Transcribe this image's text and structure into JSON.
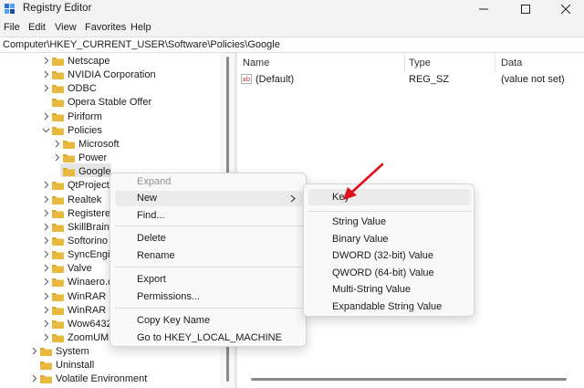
{
  "window": {
    "title": "Registry Editor"
  },
  "menu": [
    "File",
    "Edit",
    "View",
    "Favorites",
    "Help"
  ],
  "address": "Computer\\HKEY_CURRENT_USER\\Software\\Policies\\Google",
  "tree": [
    {
      "label": "Netscape",
      "state": "collapsed"
    },
    {
      "label": "NVIDIA Corporation",
      "state": "collapsed"
    },
    {
      "label": "ODBC",
      "state": "collapsed"
    },
    {
      "label": "Opera Stable Offer",
      "state": "none"
    },
    {
      "label": "Piriform",
      "state": "collapsed"
    },
    {
      "label": "Policies",
      "state": "expanded"
    },
    {
      "label": "Microsoft",
      "state": "collapsed"
    },
    {
      "label": "Power",
      "state": "collapsed"
    },
    {
      "label": "Google",
      "state": "selected"
    },
    {
      "label": "QtProject",
      "state": "collapsed"
    },
    {
      "label": "Realtek",
      "state": "collapsed"
    },
    {
      "label": "Registered",
      "state": "collapsed"
    },
    {
      "label": "SkillBrains",
      "state": "collapsed"
    },
    {
      "label": "Softorino",
      "state": "collapsed"
    },
    {
      "label": "SyncEngin",
      "state": "collapsed"
    },
    {
      "label": "Valve",
      "state": "collapsed"
    },
    {
      "label": "Winaero.c",
      "state": "collapsed"
    },
    {
      "label": "WinRAR",
      "state": "collapsed"
    },
    {
      "label": "WinRAR S",
      "state": "collapsed"
    },
    {
      "label": "Wow6432",
      "state": "collapsed"
    },
    {
      "label": "ZoomUM",
      "state": "collapsed"
    },
    {
      "label": "System",
      "state": "collapsed"
    },
    {
      "label": "Uninstall",
      "state": "none"
    },
    {
      "label": "Volatile Environment",
      "state": "collapsed"
    }
  ],
  "list": {
    "columns": [
      "Name",
      "Type",
      "Data"
    ],
    "rows": [
      {
        "name": "(Default)",
        "type": "REG_SZ",
        "data": "(value not set)"
      }
    ]
  },
  "context_menu": {
    "expand": "Expand",
    "new": "New",
    "find": "Find...",
    "delete": "Delete",
    "rename": "Rename",
    "export": "Export",
    "permissions": "Permissions...",
    "copy_key_name": "Copy Key Name",
    "goto": "Go to HKEY_LOCAL_MACHINE"
  },
  "submenu": {
    "key": "Key",
    "string": "String Value",
    "binary": "Binary Value",
    "dword": "DWORD (32-bit) Value",
    "qword": "QWORD (64-bit) Value",
    "multi": "Multi-String Value",
    "expandable": "Expandable String Value"
  },
  "colors": {
    "folder": "#e8b93c",
    "annotation_arrow": "#e0101c",
    "selection": "#e5e5e5"
  },
  "icons": {
    "app": "registry-editor-icon",
    "folder": "folder-icon",
    "value": "string-value-icon",
    "arrow": "red-arrow-annotation"
  }
}
